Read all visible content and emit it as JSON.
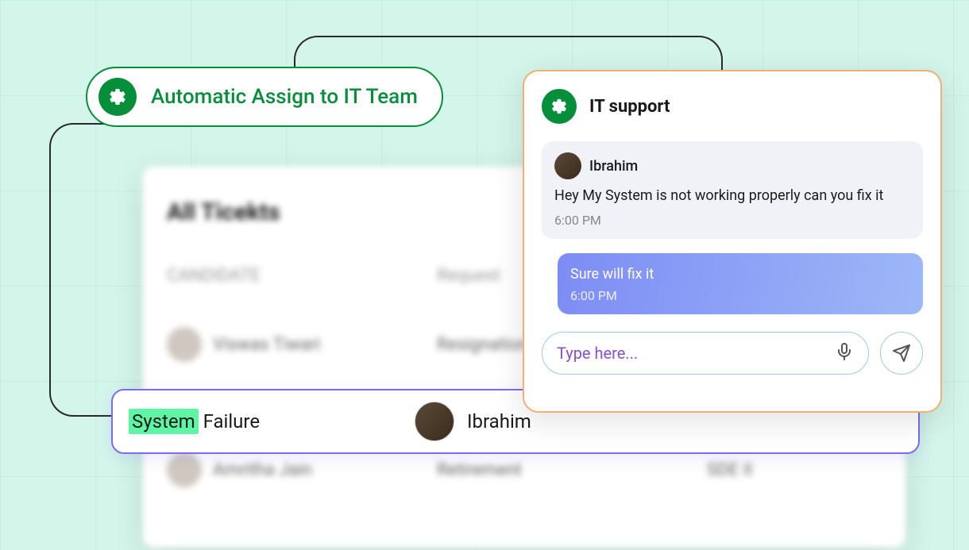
{
  "assign": {
    "label": "Automatic Assign to IT Team"
  },
  "tickets": {
    "title": "All Ticekts",
    "columns": {
      "candidate": "CANDIDATE",
      "request": "Request"
    },
    "rows": [
      {
        "name": "Viswas Tiwari",
        "request": "Resignation"
      },
      {
        "name": "Amritha Jain",
        "request": "Retirement",
        "role": "SDE II"
      }
    ]
  },
  "highlighted_ticket": {
    "type_highlight": "System",
    "type_rest": " Failure",
    "candidate": "Ibrahim"
  },
  "chat": {
    "title": "IT support",
    "messages": {
      "incoming": {
        "name": "Ibrahim",
        "body": "Hey My System is not working properly can you fix it",
        "time": "6:00 PM"
      },
      "outgoing": {
        "body": "Sure will fix it",
        "time": "6:00 PM"
      }
    },
    "input_placeholder": "Type here..."
  }
}
